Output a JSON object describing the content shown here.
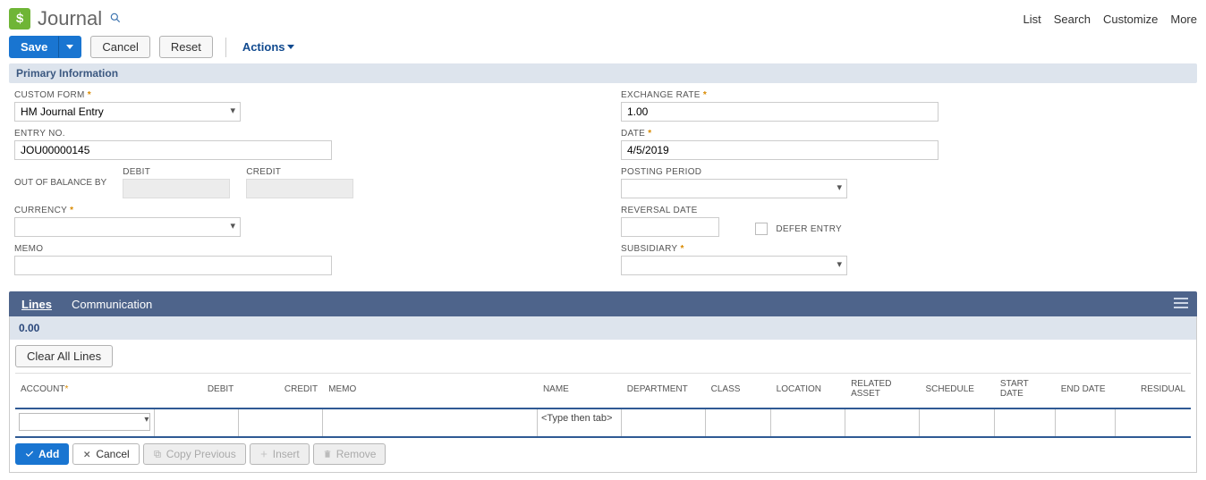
{
  "header": {
    "title": "Journal",
    "topLinks": [
      "List",
      "Search",
      "Customize",
      "More"
    ]
  },
  "toolbar": {
    "save": "Save",
    "cancel": "Cancel",
    "reset": "Reset",
    "actions": "Actions"
  },
  "sectionTitle": "Primary Information",
  "fields": {
    "customForm": {
      "label": "CUSTOM FORM",
      "value": "HM Journal Entry"
    },
    "entryNo": {
      "label": "ENTRY NO.",
      "value": "JOU00000145"
    },
    "debit": {
      "label": "DEBIT",
      "value": ""
    },
    "credit": {
      "label": "CREDIT",
      "value": ""
    },
    "outOfBalance": {
      "label": "OUT OF BALANCE BY"
    },
    "currency": {
      "label": "CURRENCY",
      "value": ""
    },
    "memo": {
      "label": "MEMO",
      "value": ""
    },
    "exchangeRate": {
      "label": "EXCHANGE RATE",
      "value": "1.00"
    },
    "date": {
      "label": "DATE",
      "value": "4/5/2019"
    },
    "postingPeriod": {
      "label": "POSTING PERIOD",
      "value": ""
    },
    "reversalDate": {
      "label": "REVERSAL DATE",
      "value": ""
    },
    "deferEntry": {
      "label": "DEFER ENTRY",
      "checked": false
    },
    "subsidiary": {
      "label": "SUBSIDIARY",
      "value": ""
    }
  },
  "tabs": {
    "lines": "Lines",
    "communication": "Communication"
  },
  "lines": {
    "total": "0.00",
    "clearAll": "Clear All Lines",
    "columns": {
      "account": "ACCOUNT",
      "debit": "DEBIT",
      "credit": "CREDIT",
      "memo": "MEMO",
      "name": "NAME",
      "department": "DEPARTMENT",
      "class": "CLASS",
      "location": "LOCATION",
      "relatedAsset": "RELATED ASSET",
      "schedule": "SCHEDULE",
      "startDate": "START DATE",
      "endDate": "END DATE",
      "residual": "RESIDUAL"
    },
    "row": {
      "namePlaceholder": "<Type then tab>"
    },
    "buttons": {
      "add": "Add",
      "cancel": "Cancel",
      "copyPrevious": "Copy Previous",
      "insert": "Insert",
      "remove": "Remove"
    }
  }
}
